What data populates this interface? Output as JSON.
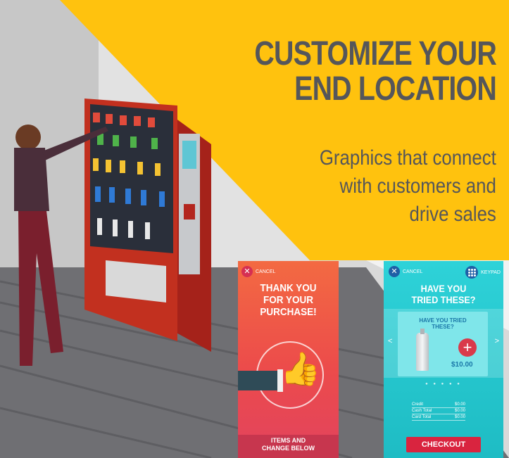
{
  "headline": [
    "CUSTOMIZE YOUR",
    "END LOCATION"
  ],
  "subheadline": [
    "Graphics that connect",
    "with customers and",
    "drive sales"
  ],
  "colors": {
    "yellow": "#ffc20e",
    "text_gray": "#55565a",
    "red_screen": "#ec4b4b",
    "teal_screen": "#1ebcc4"
  },
  "screen_thankyou": {
    "cancel_label": "CANCEL",
    "title": [
      "THANK YOU",
      "FOR YOUR",
      "PURCHASE!"
    ],
    "footer": [
      "ITEMS AND",
      "CHANGE BELOW"
    ]
  },
  "screen_upsell": {
    "cancel_label": "CANCEL",
    "keypad_label": "KEYPAD",
    "title": [
      "HAVE YOU",
      "TRIED THESE?"
    ],
    "card_title": [
      "HAVE YOU TRIED",
      "THESE?"
    ],
    "price": "$10.00",
    "prev_arrow": "<",
    "next_arrow": ">",
    "totals": [
      {
        "label": "Credit",
        "value": "$0.00"
      },
      {
        "label": "Cash Total",
        "value": "$0.00"
      },
      {
        "label": "Card Total",
        "value": "$0.00"
      }
    ],
    "checkout_label": "CHECKOUT"
  }
}
